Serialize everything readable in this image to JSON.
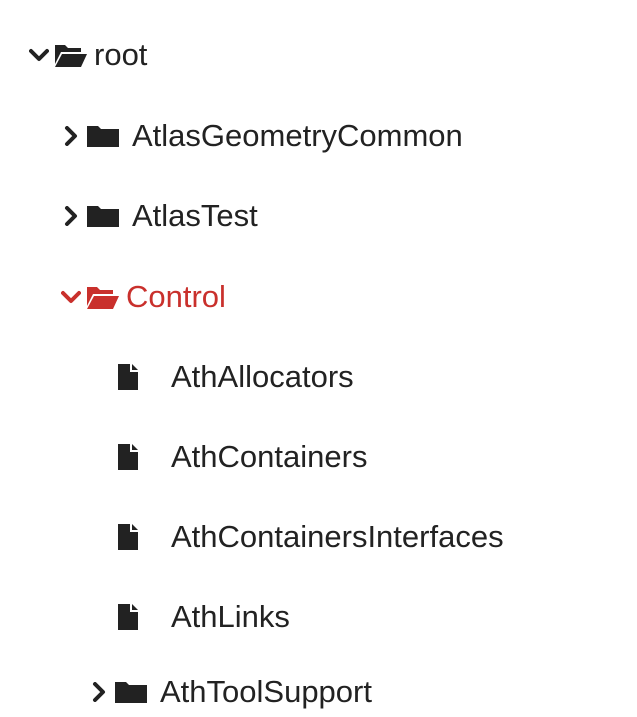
{
  "tree": {
    "root": {
      "label": "root",
      "icon": "folder-open-icon",
      "expanded": true
    },
    "items": [
      {
        "label": "AtlasGeometryCommon",
        "icon": "folder-icon",
        "expanded": false
      },
      {
        "label": "AtlasTest",
        "icon": "folder-icon",
        "expanded": false
      },
      {
        "label": "Control",
        "icon": "folder-open-icon",
        "expanded": true,
        "selected": true
      },
      {
        "label": "AthAllocators",
        "icon": "file-icon"
      },
      {
        "label": "AthContainers",
        "icon": "file-icon"
      },
      {
        "label": "AthContainersInterfaces",
        "icon": "file-icon"
      },
      {
        "label": "AthLinks",
        "icon": "file-icon"
      },
      {
        "label": "AthToolSupport",
        "icon": "folder-icon",
        "expanded": false
      }
    ]
  },
  "colors": {
    "text": "#222222",
    "selected": "#c9302c"
  }
}
